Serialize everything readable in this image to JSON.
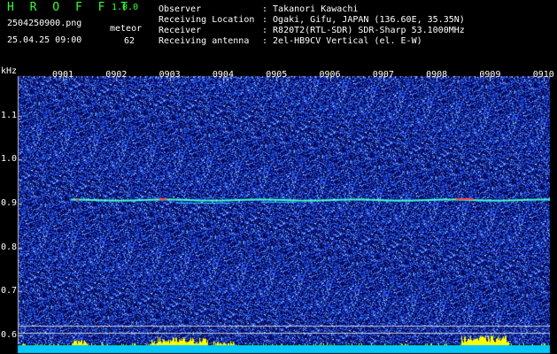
{
  "header": {
    "app_title": "H R O F F T",
    "app_version": "1.0.0",
    "filename": "2504250900.png",
    "datetime": "25.04.25 09:00",
    "mode": "meteor",
    "count": "62"
  },
  "info": [
    {
      "label": "Observer",
      "value": ": Takanori Kawachi"
    },
    {
      "label": "Receiving Location",
      "value": ": Ogaki, Gifu, JAPAN (136.60E, 35.35N)"
    },
    {
      "label": "Receiver",
      "value": ": R820T2(RTL-SDR) SDR-Sharp 53.1000MHz"
    },
    {
      "label": "Receiving antenna",
      "value": ": 2el-HB9CV Vertical (el. E-W)"
    }
  ],
  "spectrogram": {
    "y_unit": "kHz",
    "y_ticks": [
      "1.1",
      "1.0",
      "0.9",
      "0.8",
      "0.7",
      "0.6"
    ],
    "y_tick_values": [
      1.1,
      1.0,
      0.9,
      0.8,
      0.7,
      0.6
    ],
    "x_ticks": [
      "0901",
      "0902",
      "0903",
      "0904",
      "0905",
      "0906",
      "0907",
      "0908",
      "0909",
      "0910"
    ],
    "y_range": [
      0.58,
      1.19
    ],
    "carrier_khz": 0.91,
    "reference_lines_khz": [
      0.622,
      0.607
    ],
    "colors": {
      "background": "#0a0a5a",
      "noise": "#3a5cff",
      "signal": "#40ffd0",
      "hot": "#ff5050",
      "grid": "#c0c0c0",
      "activity_bar": "#ffff00",
      "floor": "#00c8ff"
    }
  }
}
